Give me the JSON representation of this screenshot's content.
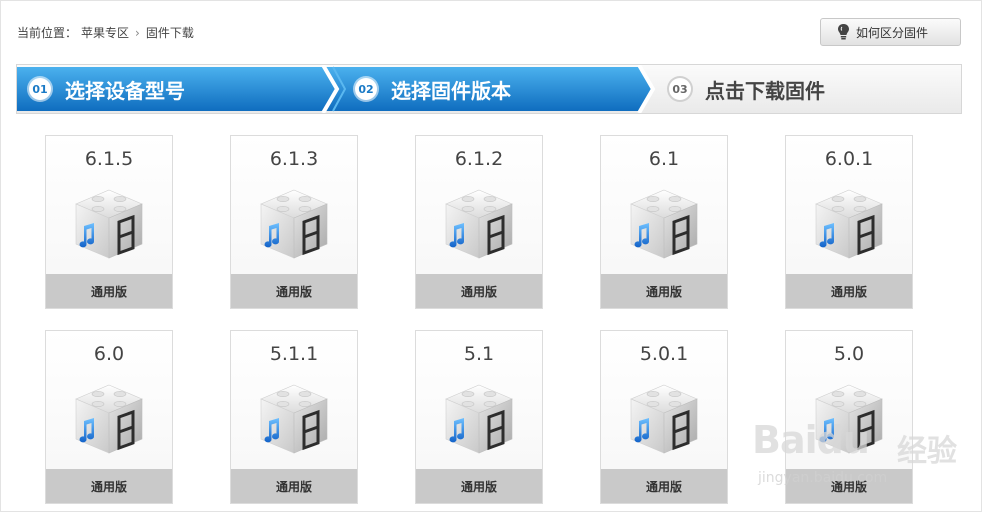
{
  "breadcrumb": {
    "prefix": "当前位置：",
    "items": [
      "苹果专区",
      "固件下载"
    ],
    "separator": "›"
  },
  "help_button": {
    "label": "如何区分固件",
    "icon": "lightbulb-icon"
  },
  "steps": [
    {
      "number": "01",
      "label": "选择设备型号",
      "state": "active"
    },
    {
      "number": "02",
      "label": "选择固件版本",
      "state": "active"
    },
    {
      "number": "03",
      "label": "点击下载固件",
      "state": "inactive"
    }
  ],
  "colors": {
    "step_active_top": "#3fa9ea",
    "step_active_bottom": "#1172c2",
    "card_footer": "#c9c9c9"
  },
  "firmware": [
    {
      "version": "6.1.5",
      "type": "通用版",
      "icon": "ipsw-cube-icon"
    },
    {
      "version": "6.1.3",
      "type": "通用版",
      "icon": "ipsw-cube-icon"
    },
    {
      "version": "6.1.2",
      "type": "通用版",
      "icon": "ipsw-cube-icon"
    },
    {
      "version": "6.1",
      "type": "通用版",
      "icon": "ipsw-cube-icon"
    },
    {
      "version": "6.0.1",
      "type": "通用版",
      "icon": "ipsw-cube-icon"
    },
    {
      "version": "6.0",
      "type": "通用版",
      "icon": "ipsw-cube-icon"
    },
    {
      "version": "5.1.1",
      "type": "通用版",
      "icon": "ipsw-cube-icon"
    },
    {
      "version": "5.1",
      "type": "通用版",
      "icon": "ipsw-cube-icon"
    },
    {
      "version": "5.0.1",
      "type": "通用版",
      "icon": "ipsw-cube-icon"
    },
    {
      "version": "5.0",
      "type": "通用版",
      "icon": "ipsw-cube-icon"
    }
  ],
  "watermark": {
    "brand": "Baidu",
    "brand_cn": "经验",
    "url": "jingyan.baidu.com"
  }
}
